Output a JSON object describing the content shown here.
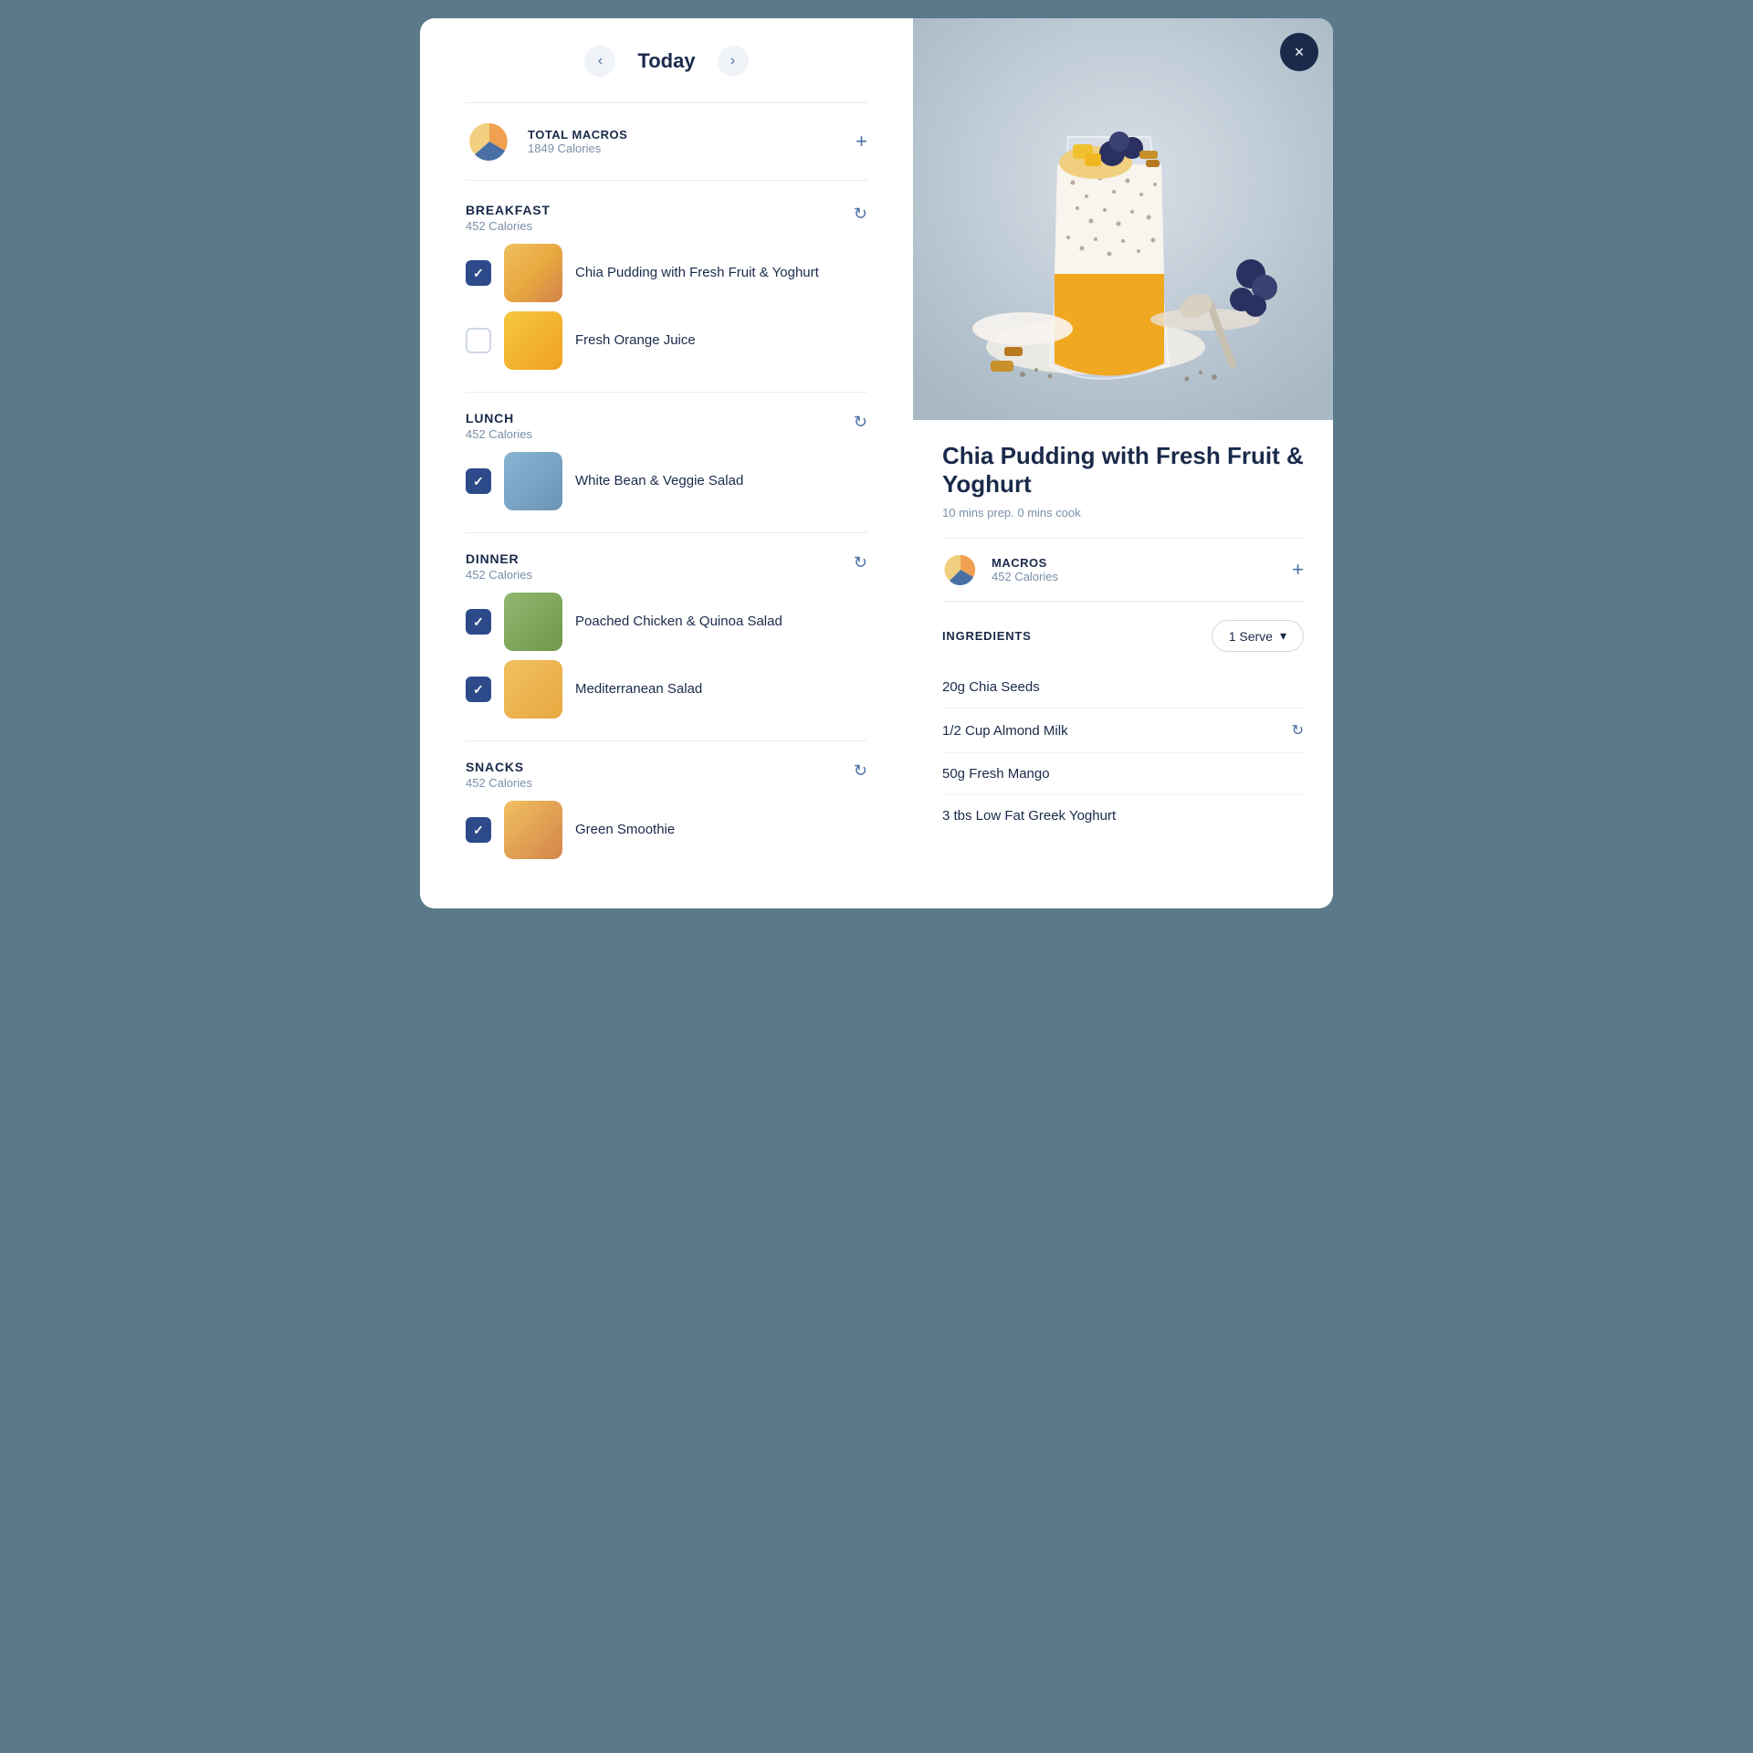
{
  "header": {
    "prev_label": "‹",
    "next_label": "›",
    "date_title": "Today"
  },
  "macros_summary": {
    "label": "TOTAL MACROS",
    "calories": "1849 Calories",
    "add_btn": "+"
  },
  "meal_sections": [
    {
      "id": "breakfast",
      "title": "BREAKFAST",
      "calories": "452 Calories",
      "items": [
        {
          "name": "Chia Pudding with Fresh Fruit & Yoghurt",
          "checked": true,
          "thumb_class": "food-thumb-chia"
        },
        {
          "name": "Fresh Orange Juice",
          "checked": false,
          "thumb_class": "food-thumb-oj"
        }
      ]
    },
    {
      "id": "lunch",
      "title": "LUNCH",
      "calories": "452 Calories",
      "items": [
        {
          "name": "White Bean & Veggie Salad",
          "checked": true,
          "thumb_class": "food-thumb-wb"
        }
      ]
    },
    {
      "id": "dinner",
      "title": "DINNER",
      "calories": "452 Calories",
      "items": [
        {
          "name": "Poached Chicken & Quinoa Salad",
          "checked": true,
          "thumb_class": "food-thumb-pq"
        },
        {
          "name": "Mediterranean Salad",
          "checked": true,
          "thumb_class": "food-thumb-med"
        }
      ]
    },
    {
      "id": "snacks",
      "title": "SNACKS",
      "calories": "452 Calories",
      "items": [
        {
          "name": "Green Smoothie",
          "checked": true,
          "thumb_class": "food-thumb-gs"
        }
      ]
    }
  ],
  "recipe_panel": {
    "title": "Chia Pudding with Fresh Fruit & Yoghurt",
    "meta": "10 mins prep. 0 mins cook",
    "macros_label": "MACROS",
    "macros_calories": "452 Calories",
    "add_btn": "+",
    "ingredients_label": "INGREDIENTS",
    "serve_dropdown": "1 Serve",
    "close_btn": "×",
    "ingredients": [
      {
        "name": "20g Chia Seeds",
        "has_swap": false
      },
      {
        "name": "1/2 Cup Almond Milk",
        "has_swap": true
      },
      {
        "name": "50g Fresh Mango",
        "has_swap": false
      },
      {
        "name": "3 tbs Low Fat Greek Yoghurt",
        "has_swap": false
      }
    ]
  }
}
